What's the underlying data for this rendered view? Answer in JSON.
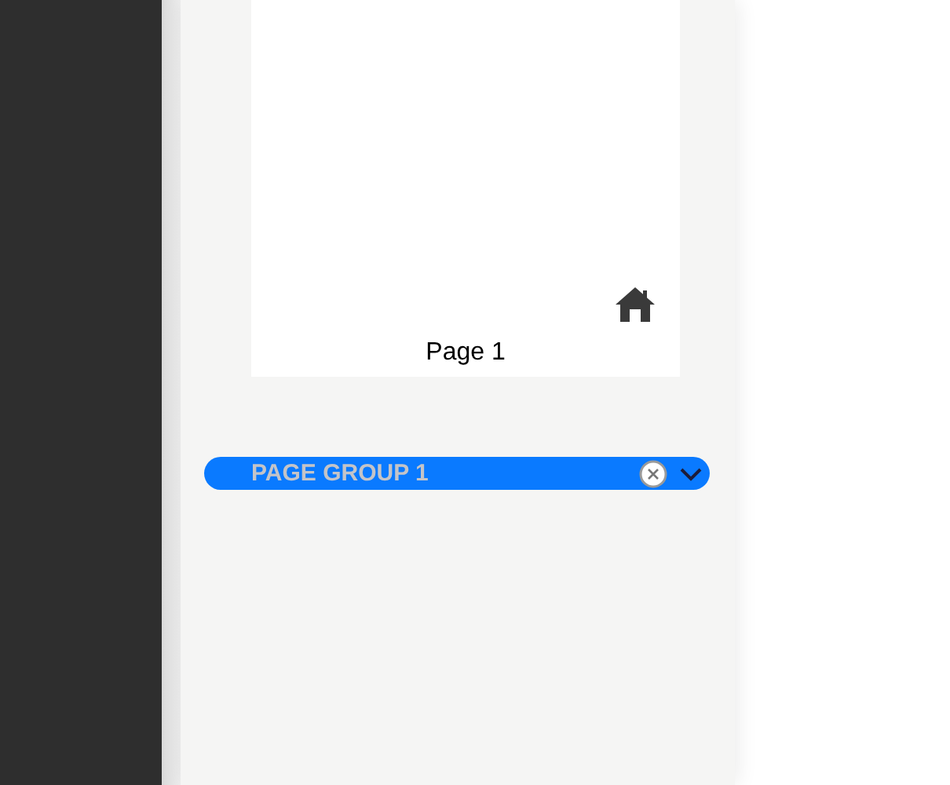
{
  "page_thumbnail": {
    "label": "Page 1"
  },
  "page_group": {
    "value": "PAGE GROUP 1"
  }
}
